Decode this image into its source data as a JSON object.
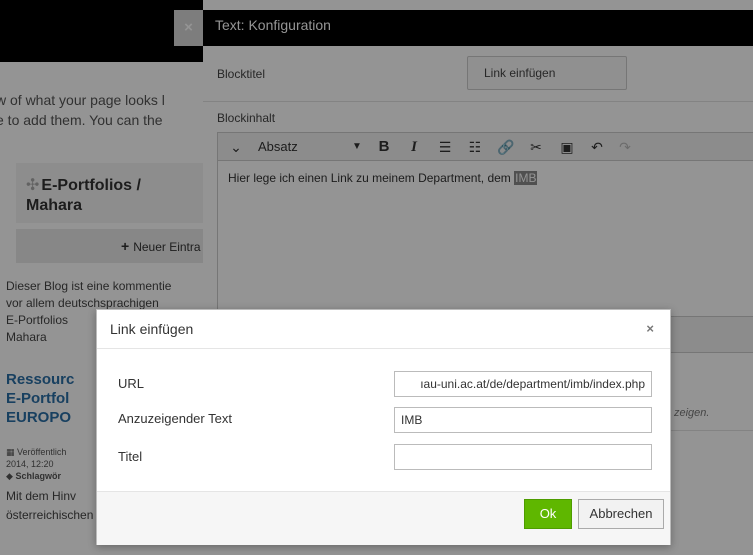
{
  "background": {
    "close_glyph": "×",
    "intro_lines": [
      "w of what your page looks l",
      "e to add them. You can the"
    ],
    "blog_title_lines": [
      "E-Portfolios /",
      "Mahara"
    ],
    "new_entry_label": "Neuer Eintra",
    "desc_lines": [
      "Dieser Blog ist eine kommentie",
      "vor allem deutschsprachigen",
      "E-Portfolios",
      "Mahara"
    ],
    "post_title_lines": [
      "Ressourc",
      "E-Portfol",
      "EUROPO"
    ],
    "meta_published": "Veröffentlich",
    "meta_time": "2014, 12:20",
    "meta_tags": "Schlagwör",
    "foot_lines": [
      "Mit dem Hinv",
      "österreichischen Chapters vor"
    ]
  },
  "config": {
    "header_title": "Text: Konfiguration",
    "block_title_label": "Blocktitel",
    "block_title_value": "Link einfügen",
    "block_content_label": "Blockinhalt",
    "toolbar": {
      "format_value": "Absatz",
      "bold": "B",
      "italic": "I"
    },
    "editor_text": "Hier lege ich einen Link zu meinem Department, dem ",
    "editor_selected": "IMB",
    "partial_hint": "zeigen."
  },
  "dialog": {
    "title": "Link einfügen",
    "close_glyph": "×",
    "url_label": "URL",
    "url_value": "ıau-uni.ac.at/de/department/imb/index.php",
    "text_label": "Anzuzeigender Text",
    "text_value": "IMB",
    "title_label": "Titel",
    "title_value": "",
    "ok_label": "Ok",
    "cancel_label": "Abbrechen"
  },
  "colors": {
    "accent_green": "#5fb700",
    "link_blue": "#2a6ea6",
    "header_black": "#000000"
  }
}
